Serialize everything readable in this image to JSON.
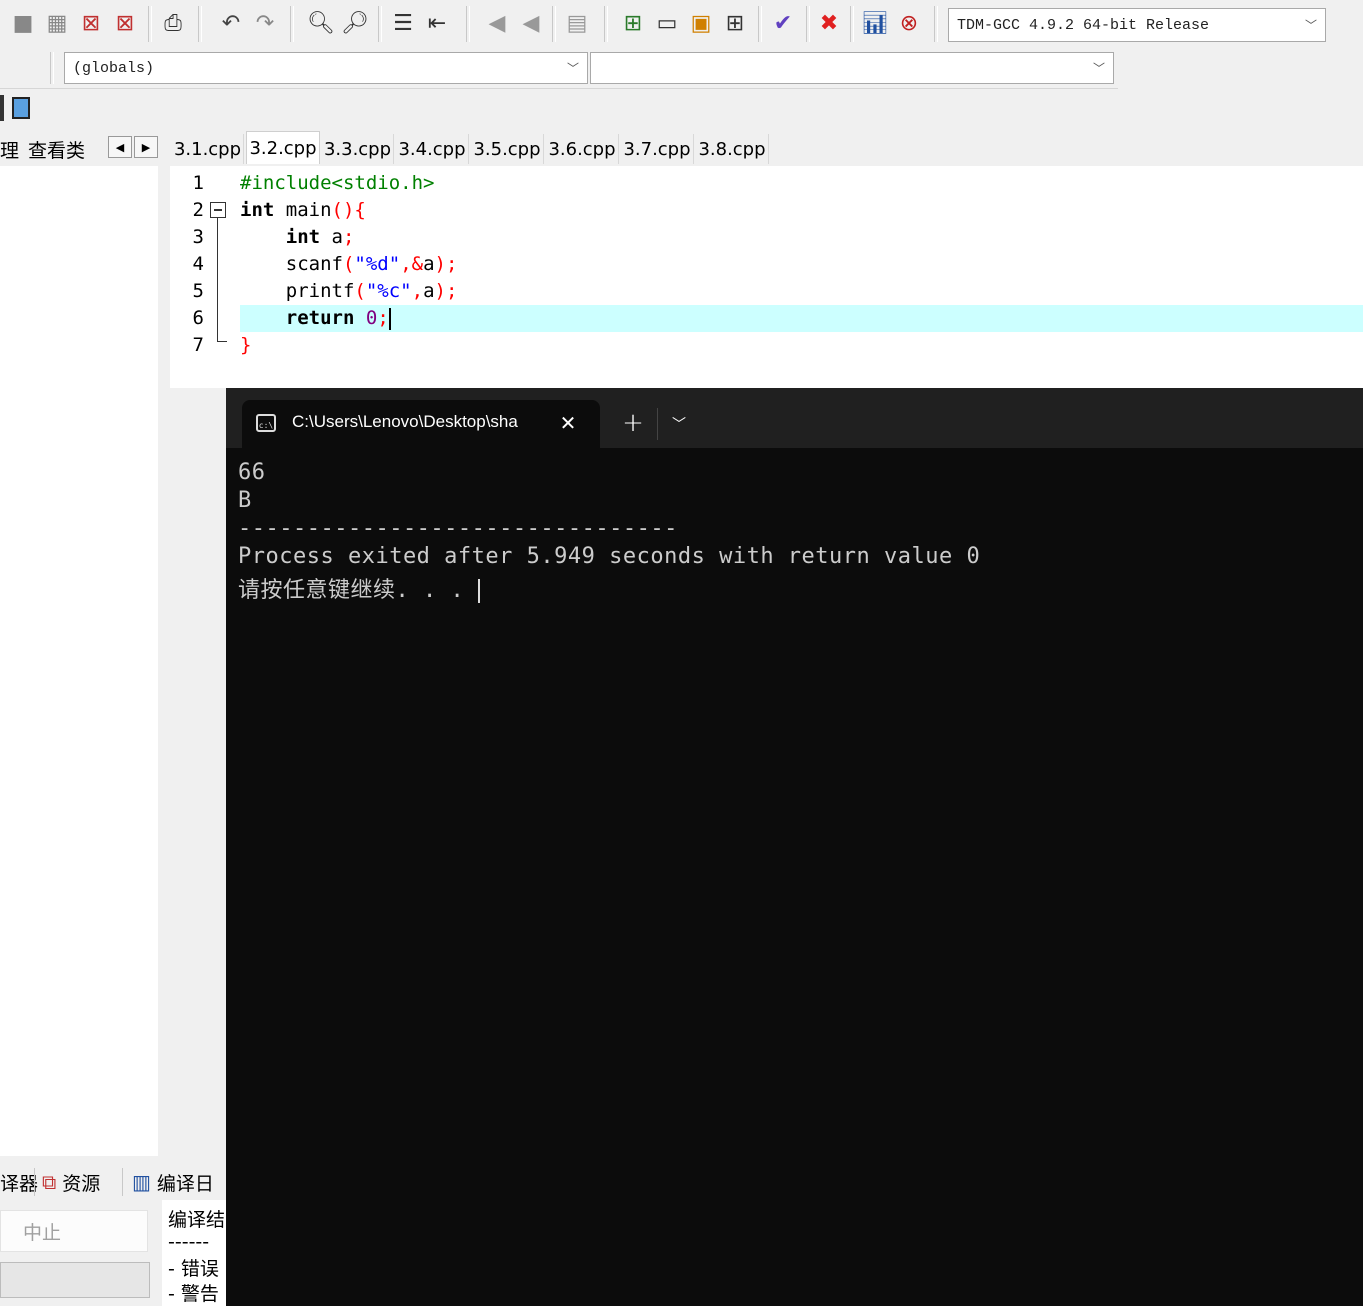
{
  "toolbar": {
    "compiler": "TDM-GCC 4.9.2 64-bit Release"
  },
  "scope": {
    "globals": "(globals)",
    "members": ""
  },
  "side_tabs": {
    "project_partial": "理",
    "classes": "查看类"
  },
  "file_tabs": [
    "3.1.cpp",
    "3.2.cpp",
    "3.3.cpp",
    "3.4.cpp",
    "3.5.cpp",
    "3.6.cpp",
    "3.7.cpp",
    "3.8.cpp"
  ],
  "active_tab": "3.2.cpp",
  "editor": {
    "line_numbers": [
      "1",
      "2",
      "3",
      "4",
      "5",
      "6",
      "7"
    ],
    "lines": {
      "l1_pp": "#include<stdio.h>",
      "l2_kw": "int",
      "l2_rest": " main",
      "l2_sym": "(){",
      "l3_kw": "int",
      "l3_rest": " a",
      "l3_sym": ";",
      "l4_fn": "scanf",
      "l4_open": "(",
      "l4_str": "\"%d\"",
      "l4_comma": ",&",
      "l4_var": "a",
      "l4_close": ");",
      "l5_fn": "printf",
      "l5_open": "(",
      "l5_str": "\"%c\"",
      "l5_comma": ",",
      "l5_var": "a",
      "l5_close": ");",
      "l6_kw": "return",
      "l6_num": "0",
      "l6_sym": ";",
      "l7_sym": "}"
    }
  },
  "bottom_tabs": {
    "compiler_partial": "译器",
    "resources": "资源",
    "compile_log": "编译日"
  },
  "stop_button": "中止",
  "compile_log_lines": [
    "编译结",
    "------",
    "- 错误",
    "- 警告"
  ],
  "terminal": {
    "title": "C:\\Users\\Lenovo\\Desktop\\sha",
    "lines": [
      "66",
      "B",
      "--------------------------------",
      "Process exited after 5.949 seconds with return value 0",
      "请按任意键继续. . . "
    ]
  },
  "colors": {
    "highlight_line": "#ccffff",
    "terminal_bg": "#0c0c0c",
    "terminal_tabbar": "#202020"
  }
}
